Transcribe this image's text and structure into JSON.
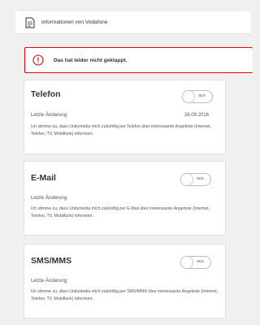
{
  "header": {
    "title": "Informationen von Vodafone",
    "icon": "document-icon"
  },
  "error": {
    "message": "Das hat leider nicht geklappt.",
    "icon": "alert-circle-icon",
    "color": "#e60000"
  },
  "cards": [
    {
      "title": "Telefon",
      "toggle_label": "aus",
      "last_change_label": "Letzte Änderung:",
      "last_change_date": "26.09.2016",
      "description": "Ich stimme zu, dass Unitymedia mich zukünftig per Telefon über interessante Angebote (Internet, Telefon, TV, Mobilfunk) informiert."
    },
    {
      "title": "E-Mail",
      "toggle_label": "aus",
      "last_change_label": "Letzte Änderung:",
      "last_change_date": "",
      "description": "Ich stimme zu, dass Unitymedia mich zukünftig per E-Mail über interessante Angebote (Internet, Telefon, TV, Mobilfunk) informiert."
    },
    {
      "title": "SMS/MMS",
      "toggle_label": "aus",
      "last_change_label": "Letzte Änderung:",
      "last_change_date": "",
      "description": "Ich stimme zu, dass Unitymedia mich zukünftig per SMS/MMS über interessante Angebote (Internet, Telefon, TV, Mobilfunk) informiert."
    }
  ]
}
